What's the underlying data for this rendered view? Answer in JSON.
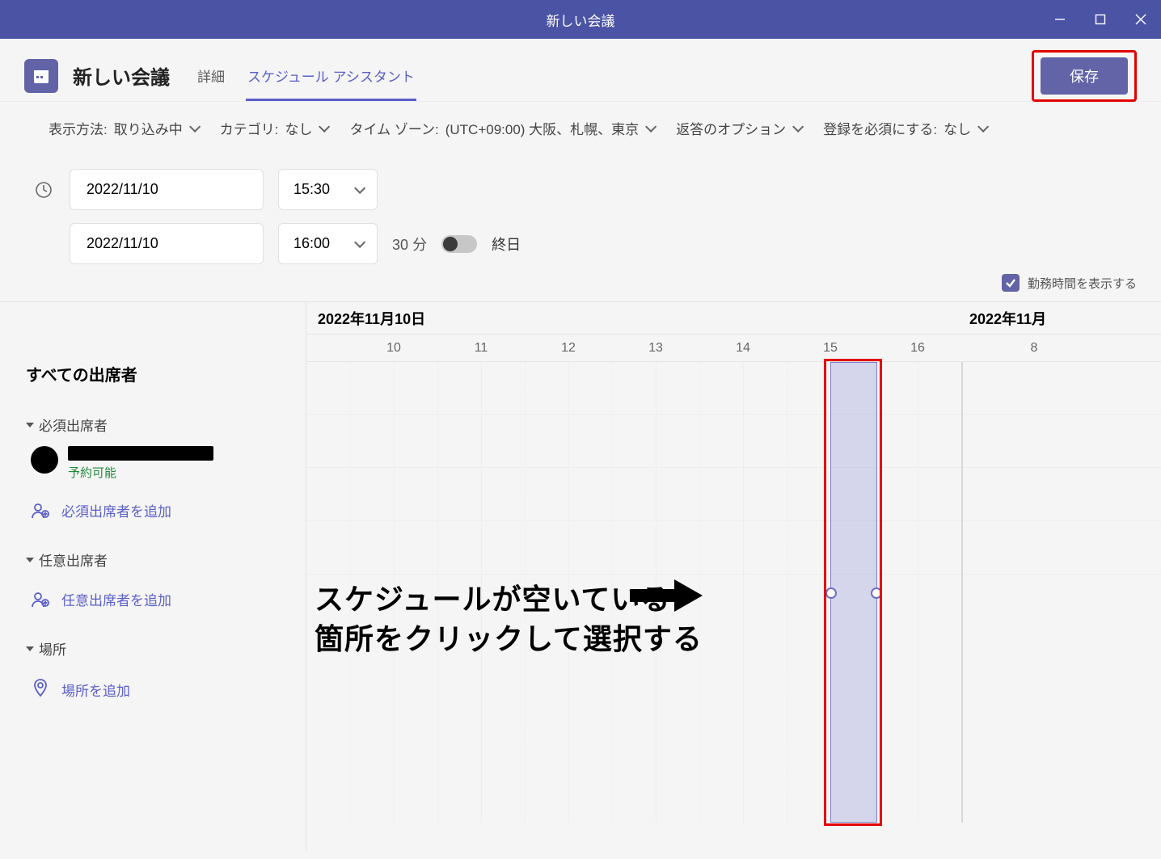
{
  "window": {
    "title": "新しい会議"
  },
  "header": {
    "page_title": "新しい会議",
    "tabs": {
      "details": "詳細",
      "assistant": "スケジュール アシスタント"
    },
    "save_label": "保存"
  },
  "options": {
    "show_as_label": "表示方法:",
    "show_as_value": "取り込み中",
    "category_label": "カテゴリ:",
    "category_value": "なし",
    "timezone_label": "タイム ゾーン:",
    "timezone_value": "(UTC+09:00) 大阪、札幌、東京",
    "response_label": "返答のオプション",
    "registration_label": "登録を必須にする:",
    "registration_value": "なし"
  },
  "datetime": {
    "start_date": "2022/11/10",
    "start_time": "15:30",
    "end_date": "2022/11/10",
    "end_time": "16:00",
    "duration": "30 分",
    "allday": "終日",
    "workhours": "勤務時間を表示する"
  },
  "sidebar": {
    "all_attendees": "すべての出席者",
    "required_header": "必須出席者",
    "attendee_status": "予約可能",
    "add_required": "必須出席者を追加",
    "optional_header": "任意出席者",
    "add_optional": "任意出席者を追加",
    "location_header": "場所",
    "add_location": "場所を追加"
  },
  "grid": {
    "date_main": "2022年11月10日",
    "date_next": "2022年11月",
    "hours": [
      "10",
      "11",
      "12",
      "13",
      "14",
      "15",
      "16"
    ],
    "next_slot": "8"
  },
  "annotation": {
    "line1": "スケジュールが空いている",
    "line2": "箇所をクリックして選択する"
  }
}
